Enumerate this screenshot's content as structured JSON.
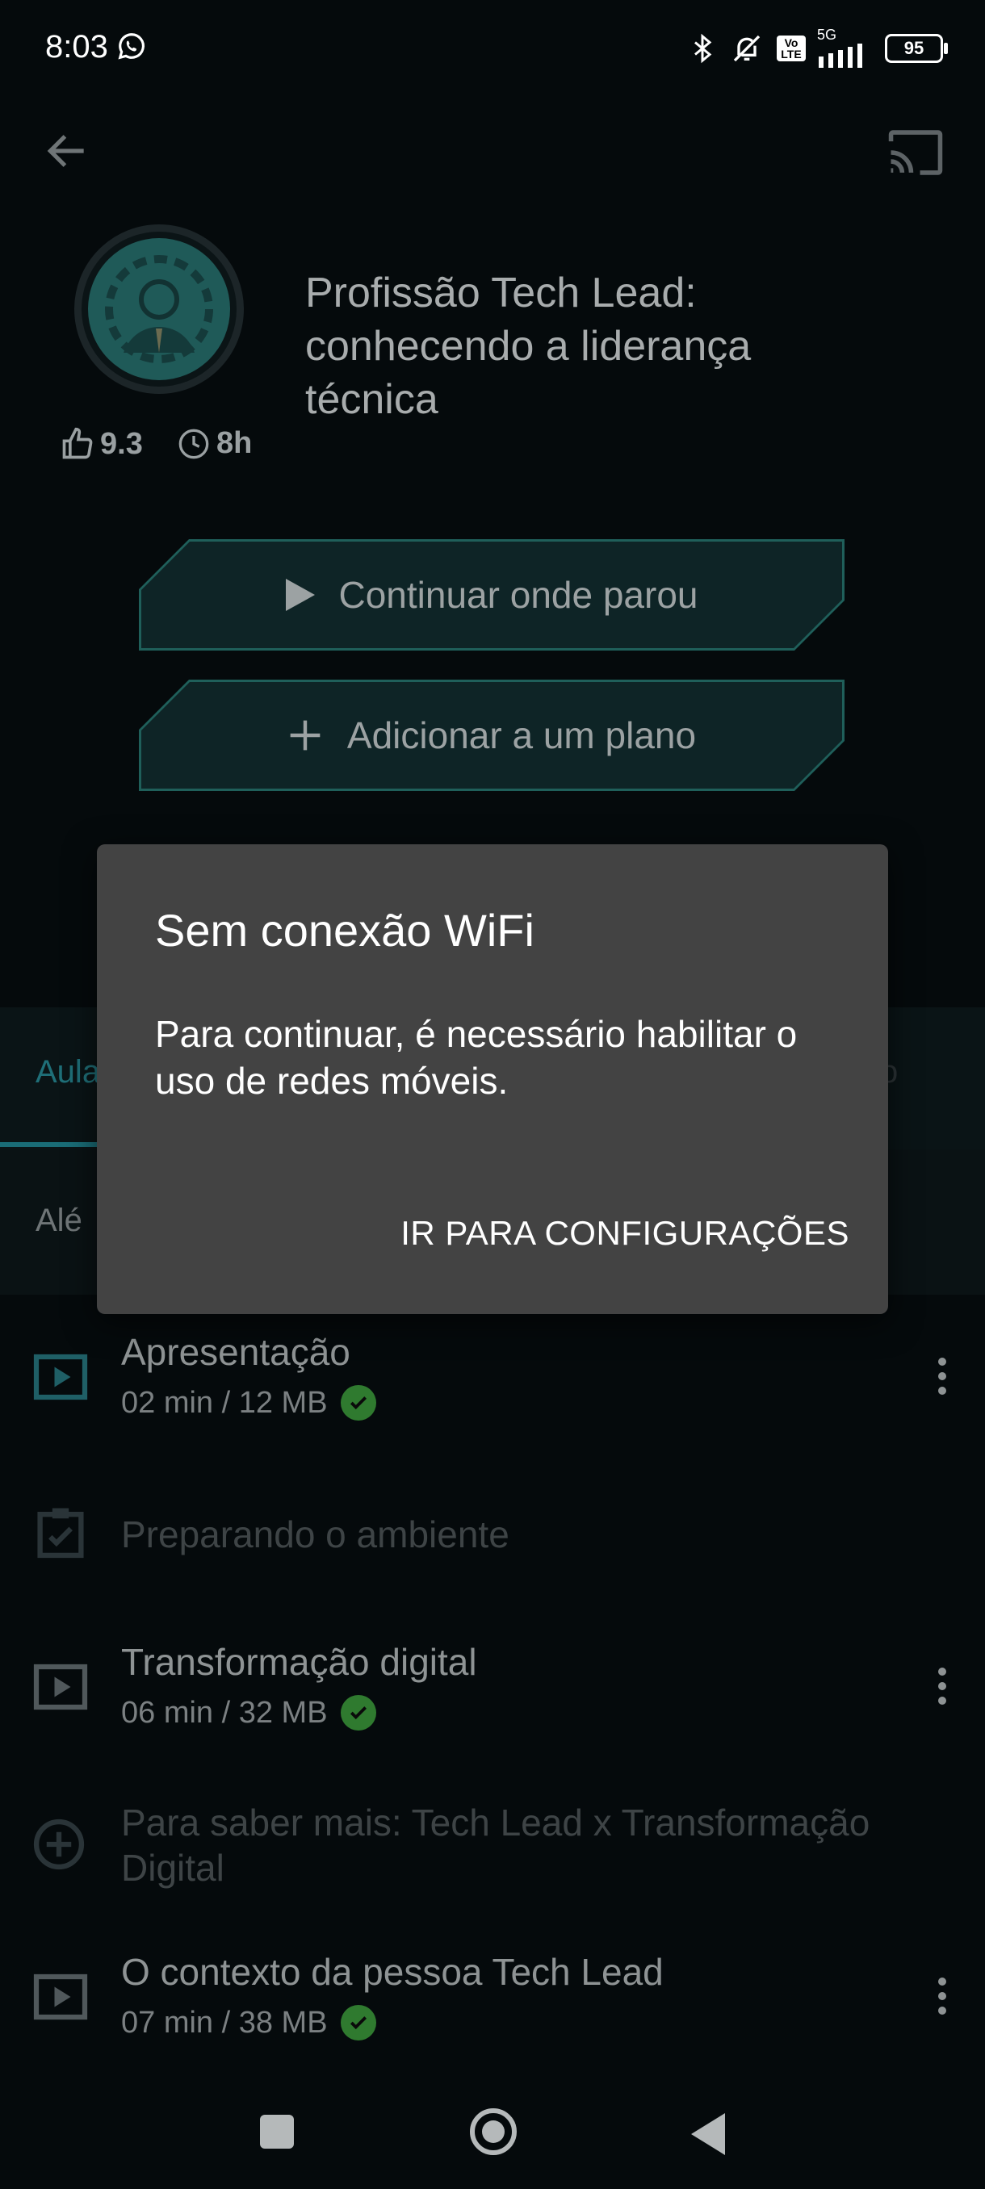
{
  "status_bar": {
    "time": "8:03",
    "network": "5G",
    "volte_top": "Vo",
    "volte_bottom": "LTE",
    "battery": "95"
  },
  "course": {
    "title": "Profissão Tech Lead: conhecendo a liderança técnica",
    "rating": "9.3",
    "duration": "8h"
  },
  "actions": {
    "continue_label": "Continuar onde parou",
    "add_label": "Adicionar a um plano"
  },
  "tabs": {
    "left_partial": "Aula",
    "right_partial": "o"
  },
  "subfilter": {
    "partial": "Alé"
  },
  "lessons": [
    {
      "title": "Apresentação",
      "meta": "02 min / 12 MB",
      "icon": "play-lesson-icon",
      "downloaded": true
    },
    {
      "title": "Preparando o ambiente",
      "icon": "checklist-icon",
      "downloaded": false
    },
    {
      "title": "Transformação digital",
      "meta": "06 min / 32 MB",
      "icon": "play-lesson-icon",
      "downloaded": true
    },
    {
      "title": "Para saber mais: Tech Lead x Transformação Digital",
      "icon": "plus-circle-icon",
      "downloaded": false
    },
    {
      "title": "O contexto da pessoa Tech Lead",
      "meta": "07 min / 38 MB",
      "icon": "play-lesson-icon",
      "downloaded": true
    }
  ],
  "dialog": {
    "title": "Sem conexão WiFi",
    "message": "Para continuar, é necessário habilitar o uso de redes móveis.",
    "action": "IR PARA CONFIGURAÇÕES"
  },
  "colors": {
    "accent": "#1a6d77",
    "check": "#2f7a2f",
    "dialog_bg": "#434343"
  }
}
